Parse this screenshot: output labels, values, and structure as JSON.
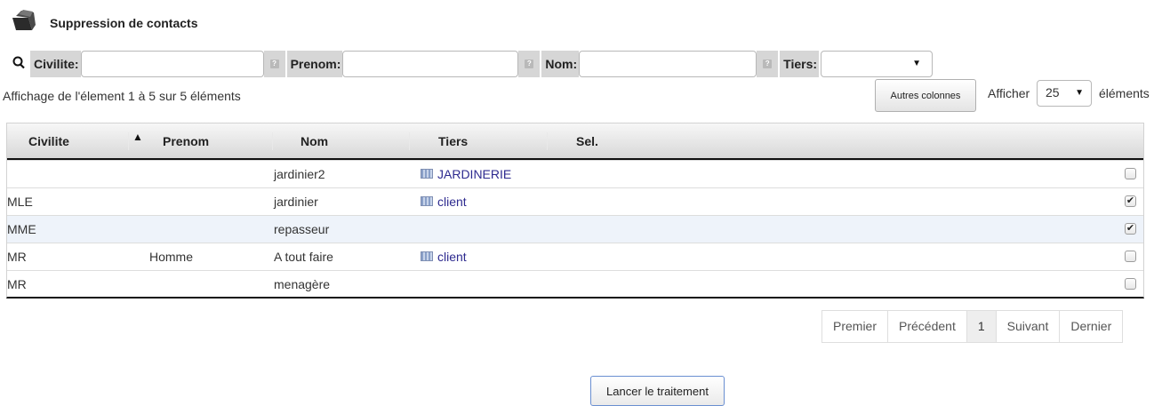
{
  "header": {
    "title": "Suppression de contacts",
    "icon": "folder-icon"
  },
  "filters": [
    {
      "label": "Civilite:",
      "value": "",
      "placeholder": ""
    },
    {
      "label": "Prenom:",
      "value": "",
      "placeholder": ""
    },
    {
      "label": "Nom:",
      "value": "",
      "placeholder": ""
    }
  ],
  "tiers_filter": {
    "label": "Tiers:",
    "value": ""
  },
  "info": "Affichage de l'élement 1 à 5 sur 5 éléments",
  "toolbar": {
    "other_columns": "Autres colonnes",
    "show_label": "Afficher",
    "page_size": "25",
    "show_suffix": "éléments"
  },
  "table": {
    "columns": [
      "Civilite",
      "Prenom",
      "Nom",
      "Tiers",
      "Sel."
    ],
    "sorted_column": "Civilite",
    "rows": [
      {
        "civilite": "",
        "prenom": "",
        "nom": "jardinier2",
        "tiers": "JARDINERIE",
        "selected": false
      },
      {
        "civilite": "MLE",
        "prenom": "",
        "nom": "jardinier",
        "tiers": "client",
        "selected": true
      },
      {
        "civilite": "MME",
        "prenom": "",
        "nom": "repasseur",
        "tiers": "",
        "selected": true
      },
      {
        "civilite": "MR",
        "prenom": "Homme",
        "nom": "A tout faire",
        "tiers": "client",
        "selected": false
      },
      {
        "civilite": "MR",
        "prenom": "",
        "nom": "menagère",
        "tiers": "",
        "selected": false
      }
    ]
  },
  "pagination": {
    "first": "Premier",
    "prev": "Précédent",
    "current": "1",
    "next": "Suivant",
    "last": "Dernier"
  },
  "actions": {
    "run": "Lancer le traitement"
  },
  "colors": {
    "link": "#2d2a8f",
    "label_bg": "#d6d6d6",
    "run_border": "#6a8fd1"
  }
}
